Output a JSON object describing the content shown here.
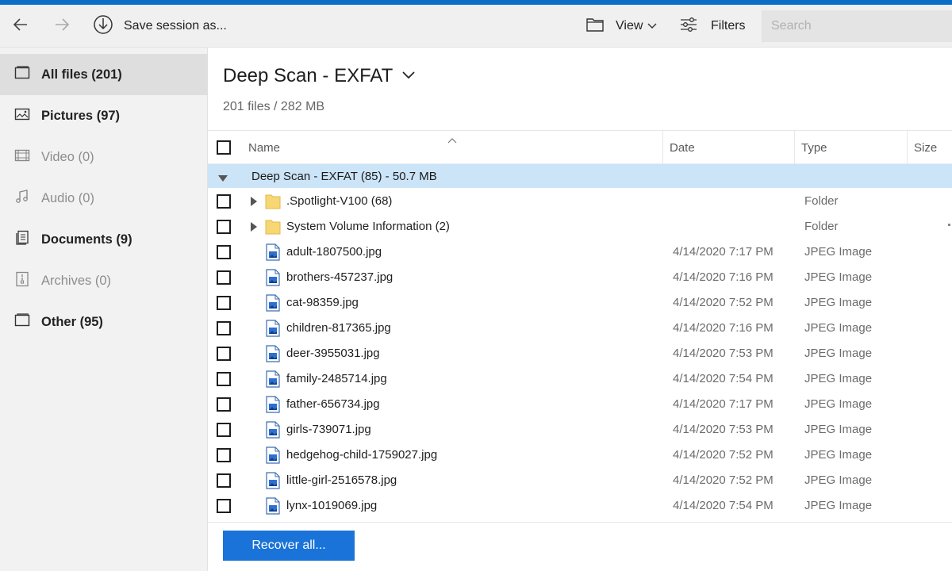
{
  "colors": {
    "accent": "#0b6fc6",
    "button": "#1a73d8",
    "group_bg": "#cce4f7",
    "sidebar_bg": "#f2f2f2",
    "folder": "#f7d774"
  },
  "toolbar": {
    "back_icon": "arrow-left-icon",
    "forward_icon": "arrow-right-icon",
    "save_session_label": "Save session as...",
    "view_label": "View",
    "filters_label": "Filters",
    "search_placeholder": "Search"
  },
  "sidebar": {
    "items": [
      {
        "label": "All files (201)",
        "icon": "all-files-icon",
        "active": true,
        "disabled": false
      },
      {
        "label": "Pictures (97)",
        "icon": "pictures-icon",
        "active": false,
        "disabled": false
      },
      {
        "label": "Video (0)",
        "icon": "video-icon",
        "active": false,
        "disabled": true
      },
      {
        "label": "Audio (0)",
        "icon": "audio-icon",
        "active": false,
        "disabled": true
      },
      {
        "label": "Documents (9)",
        "icon": "documents-icon",
        "active": false,
        "disabled": false
      },
      {
        "label": "Archives (0)",
        "icon": "archives-icon",
        "active": false,
        "disabled": true
      },
      {
        "label": "Other (95)",
        "icon": "other-icon",
        "active": false,
        "disabled": false
      }
    ]
  },
  "main": {
    "title": "Deep Scan - EXFAT",
    "subtitle": "201 files / 282 MB",
    "columns": {
      "name": "Name",
      "date": "Date",
      "type": "Type",
      "size": "Size"
    },
    "group": {
      "label": "Deep Scan - EXFAT (85) - 50.7 MB"
    },
    "rows": [
      {
        "name": ".Spotlight-V100 (68)",
        "date": "",
        "type": "Folder",
        "kind": "folder"
      },
      {
        "name": "System Volume Information (2)",
        "date": "",
        "type": "Folder",
        "kind": "folder"
      },
      {
        "name": "adult-1807500.jpg",
        "date": "4/14/2020 7:17 PM",
        "type": "JPEG Image",
        "kind": "image"
      },
      {
        "name": "brothers-457237.jpg",
        "date": "4/14/2020 7:16 PM",
        "type": "JPEG Image",
        "kind": "image"
      },
      {
        "name": "cat-98359.jpg",
        "date": "4/14/2020 7:52 PM",
        "type": "JPEG Image",
        "kind": "image"
      },
      {
        "name": "children-817365.jpg",
        "date": "4/14/2020 7:16 PM",
        "type": "JPEG Image",
        "kind": "image"
      },
      {
        "name": "deer-3955031.jpg",
        "date": "4/14/2020 7:53 PM",
        "type": "JPEG Image",
        "kind": "image"
      },
      {
        "name": "family-2485714.jpg",
        "date": "4/14/2020 7:54 PM",
        "type": "JPEG Image",
        "kind": "image"
      },
      {
        "name": "father-656734.jpg",
        "date": "4/14/2020 7:17 PM",
        "type": "JPEG Image",
        "kind": "image"
      },
      {
        "name": "girls-739071.jpg",
        "date": "4/14/2020 7:53 PM",
        "type": "JPEG Image",
        "kind": "image"
      },
      {
        "name": "hedgehog-child-1759027.jpg",
        "date": "4/14/2020 7:52 PM",
        "type": "JPEG Image",
        "kind": "image"
      },
      {
        "name": "little-girl-2516578.jpg",
        "date": "4/14/2020 7:52 PM",
        "type": "JPEG Image",
        "kind": "image"
      },
      {
        "name": "lynx-1019069.jpg",
        "date": "4/14/2020 7:54 PM",
        "type": "JPEG Image",
        "kind": "image"
      }
    ]
  },
  "footer": {
    "recover_label": "Recover all..."
  }
}
